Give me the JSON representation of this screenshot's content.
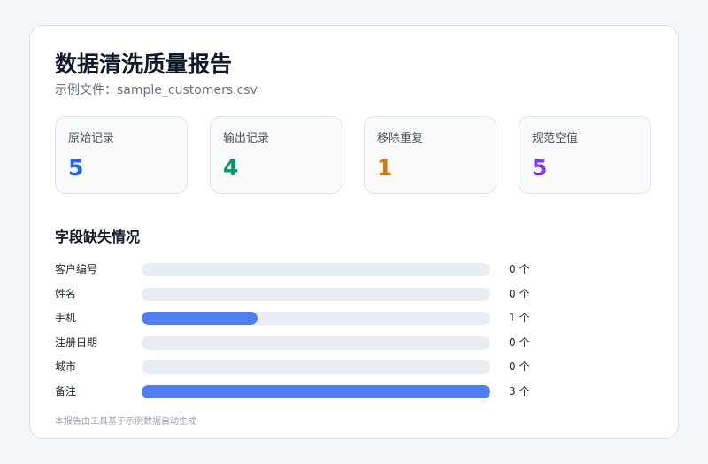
{
  "report": {
    "title": "数据清洗质量报告",
    "subtitle": "示例文件：sample_customers.csv",
    "section_title": "字段缺失情况",
    "footer": "本报告由工具基于示例数据自动生成"
  },
  "stats": [
    {
      "label": "原始记录",
      "value": "5",
      "color": "#2563eb"
    },
    {
      "label": "输出记录",
      "value": "4",
      "color": "#059669"
    },
    {
      "label": "移除重复",
      "value": "1",
      "color": "#d97706"
    },
    {
      "label": "规范空值",
      "value": "5",
      "color": "#7c3aed"
    }
  ],
  "missing": {
    "max_count": 3,
    "bar_color": "#4f7ef2",
    "fields": [
      {
        "name": "客户编号",
        "count": 0,
        "count_label": "0 个"
      },
      {
        "name": "姓名",
        "count": 0,
        "count_label": "0 个"
      },
      {
        "name": "手机",
        "count": 1,
        "count_label": "1 个"
      },
      {
        "name": "注册日期",
        "count": 0,
        "count_label": "0 个"
      },
      {
        "name": "城市",
        "count": 0,
        "count_label": "0 个"
      },
      {
        "name": "备注",
        "count": 3,
        "count_label": "3 个"
      }
    ]
  }
}
